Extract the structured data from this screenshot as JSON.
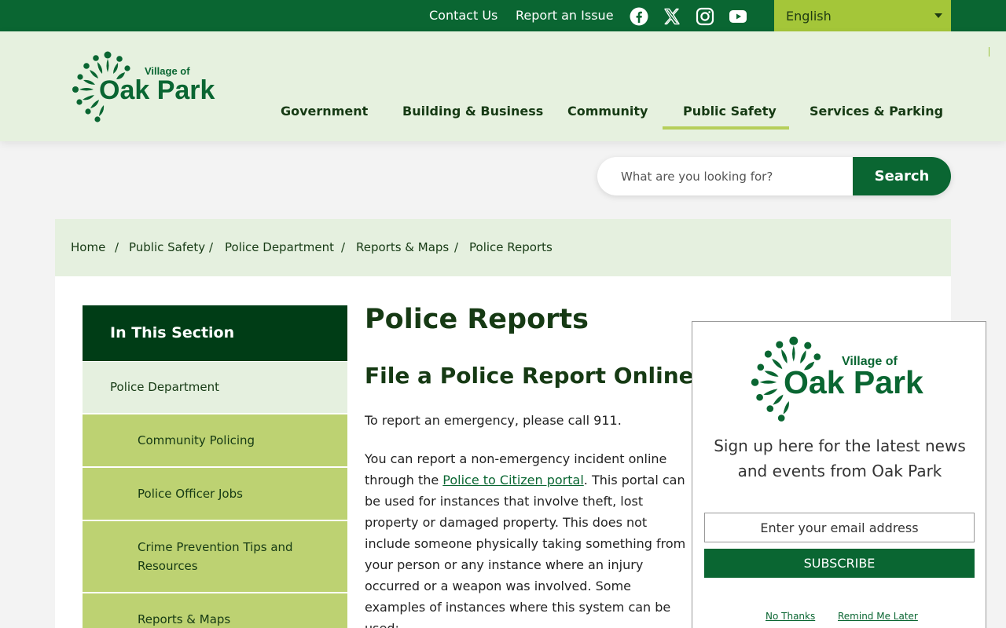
{
  "topbar": {
    "contact_label": "Contact Us",
    "report_label": "Report an Issue",
    "social_icons": [
      "facebook-icon",
      "x-twitter-icon",
      "instagram-icon",
      "youtube-icon"
    ],
    "language": "English"
  },
  "logo": {
    "line1": "Village of",
    "line2": "Oak Park"
  },
  "nav": {
    "items": [
      {
        "label": "Government"
      },
      {
        "label": "Building & Business"
      },
      {
        "label": "Community"
      },
      {
        "label": "Public Safety",
        "active": true
      },
      {
        "label": "Services & Parking"
      }
    ]
  },
  "search": {
    "placeholder": "What are you looking for?",
    "button_label": "Search"
  },
  "breadcrumb": {
    "items": [
      "Home",
      "Public Safety",
      "Police Department",
      "Reports & Maps",
      "Police Reports"
    ],
    "separator": "/"
  },
  "sidebar": {
    "heading": "In This Section",
    "parent": "Police Department",
    "items": [
      {
        "line1": "Community Policing"
      },
      {
        "line1": "Police Officer Jobs"
      },
      {
        "line1": "Crime Prevention Tips and",
        "line2": "Resources"
      },
      {
        "line1": "Reports & Maps"
      }
    ]
  },
  "content": {
    "title": "Police Reports",
    "subtitle": "File a Police Report Online",
    "para1": "To report an emergency, please call 911.",
    "para2_before": "You can report a non-emergency incident online through the ",
    "para2_link": "Police to Citizen portal",
    "para2_after": ". This portal can be used for instances that involve theft, lost property or damaged property. This does not include someone physically taking something from your person or any instance where an injury occurred or a weapon was involved. Some examples of instances where this system can be used:"
  },
  "popup": {
    "logo_line1": "Village of",
    "logo_line2": "Oak Park",
    "text": "Sign up here for the latest news and events from Oak Park",
    "email_placeholder": "Enter your email address",
    "subscribe_label": "SUBSCRIBE",
    "no_thanks": "No Thanks",
    "remind_later": "Remind Me Later"
  },
  "colors": {
    "brand_green": "#0a6632",
    "dark_green": "#003d16",
    "lime": "#a4c639",
    "pale_green": "#e5f0df",
    "side_child": "#bdd272"
  }
}
